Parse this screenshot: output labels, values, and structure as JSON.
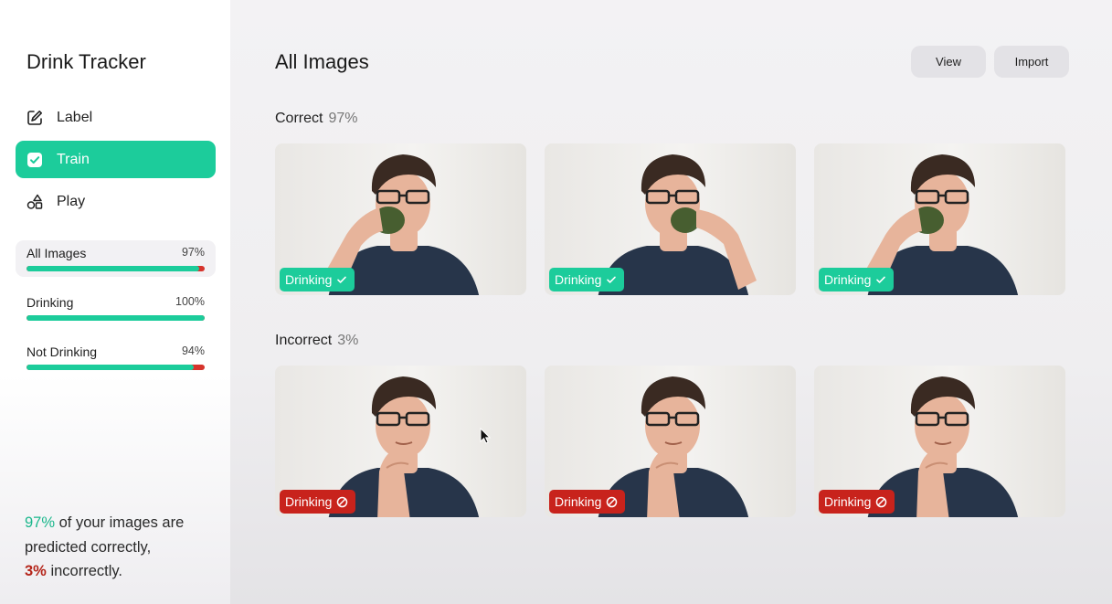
{
  "app": {
    "title": "Drink Tracker"
  },
  "nav": [
    {
      "label": "Label",
      "icon": "pencil-icon",
      "active": false
    },
    {
      "label": "Train",
      "icon": "checkbox-icon",
      "active": true
    },
    {
      "label": "Play",
      "icon": "shapes-icon",
      "active": false
    }
  ],
  "stats": [
    {
      "label": "All Images",
      "pct_text": "97%",
      "value": 0.97,
      "selected": true
    },
    {
      "label": "Drinking",
      "pct_text": "100%",
      "value": 1.0,
      "selected": false
    },
    {
      "label": "Not Drinking",
      "pct_text": "94%",
      "value": 0.94,
      "selected": false
    }
  ],
  "summary": {
    "correct_pct": "97%",
    "line1_rest": " of your images are predicted correctly,",
    "incorrect_pct": "3%",
    "line2_rest": " incorrectly."
  },
  "main": {
    "title": "All Images",
    "view_label": "View",
    "import_label": "Import"
  },
  "sections": {
    "correct": {
      "label": "Correct",
      "pct": "97%"
    },
    "incorrect": {
      "label": "Incorrect",
      "pct": "3%"
    }
  },
  "cards": {
    "correct": [
      {
        "badge": "Drinking",
        "status": "correct",
        "pose": "drinking-left"
      },
      {
        "badge": "Drinking",
        "status": "correct",
        "pose": "drinking-center"
      },
      {
        "badge": "Drinking",
        "status": "correct",
        "pose": "drinking-left"
      }
    ],
    "incorrect": [
      {
        "badge": "Drinking",
        "status": "incorrect",
        "pose": "thinking"
      },
      {
        "badge": "Drinking",
        "status": "incorrect",
        "pose": "thinking"
      },
      {
        "badge": "Drinking",
        "status": "incorrect",
        "pose": "thinking"
      }
    ]
  },
  "colors": {
    "accent": "#1ccc9b",
    "error": "#c8231c",
    "shirt": "#27354a",
    "hair": "#3a2a22",
    "skin": "#e7b49b"
  }
}
